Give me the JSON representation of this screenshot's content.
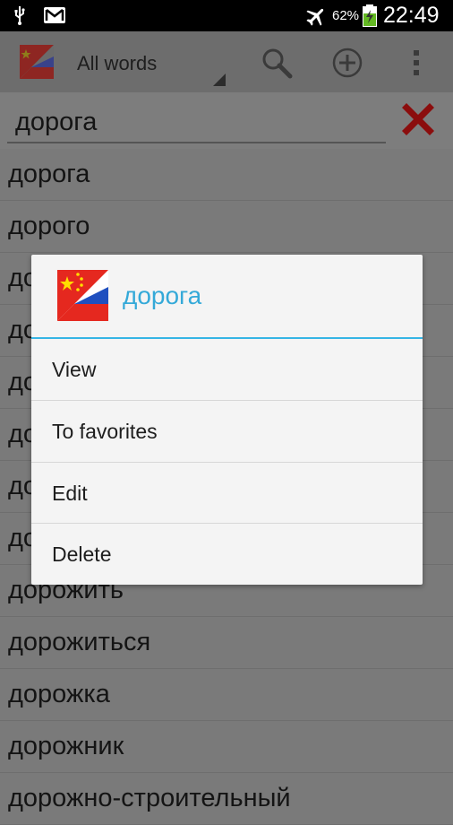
{
  "status_bar": {
    "battery_percent": "62%",
    "time": "22:49",
    "icons": [
      "usb-icon",
      "gmail-icon",
      "airplane-mode-icon",
      "battery-charging-icon"
    ]
  },
  "action_bar": {
    "title": "All words",
    "icons": [
      "app-flag-icon",
      "search-icon",
      "add-circle-icon",
      "overflow-menu-icon"
    ]
  },
  "search": {
    "value": "дорога"
  },
  "list": {
    "items": [
      "дорога",
      "дорого",
      "до",
      "до",
      "до",
      "до",
      "до",
      "до",
      "дорожить",
      "дорожиться",
      "дорожка",
      "дорожник",
      "дорожно-строительный"
    ]
  },
  "dialog": {
    "title": "дорога",
    "items": [
      "View",
      "To favorites",
      "Edit",
      "Delete"
    ]
  },
  "colors": {
    "accent": "#35b5e5",
    "dialog_title": "#34a9d8",
    "clear_red": "#8b0d0d",
    "flag_red": "#e5281f",
    "flag_yellow": "#ffde00",
    "flag_blue": "#1f4fbf"
  }
}
